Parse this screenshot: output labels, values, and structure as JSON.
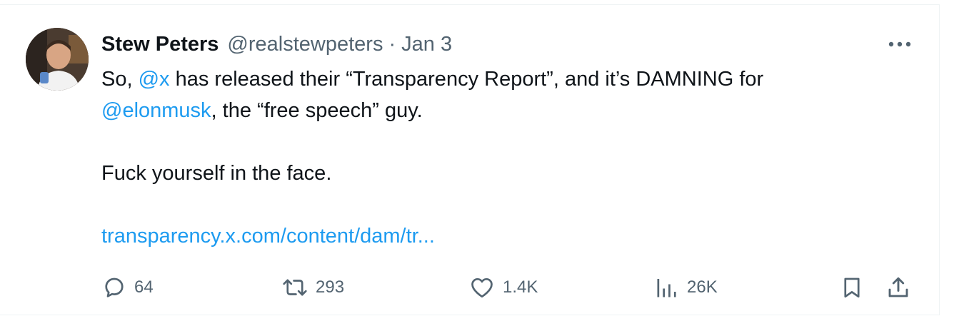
{
  "author": {
    "name": "Stew Peters",
    "handle": "@realstewpeters",
    "separator": "·",
    "date": "Jan 3"
  },
  "tweet": {
    "line1_prefix": "So, ",
    "line1_mention": "@x",
    "line1_suffix": " has released their “Transparency Report”, and it’s DAMNING for",
    "line2_mention": "@elonmusk",
    "line2_suffix": ", the “free speech” guy.",
    "line3": "Fuck yourself in the face.",
    "link": "transparency.x.com/content/dam/tr..."
  },
  "actions": {
    "replies": "64",
    "reposts": "293",
    "likes": "1.4K",
    "views": "26K"
  },
  "icons": {
    "more": "more-dots-icon",
    "reply": "reply-bubble-icon",
    "repost": "repost-icon",
    "like": "heart-icon",
    "views": "views-bar-chart-icon",
    "bookmark": "bookmark-icon",
    "share": "share-icon"
  },
  "colors": {
    "text": "#0f1419",
    "muted": "#536471",
    "link": "#1d9bf0",
    "border": "#eff3f4"
  }
}
